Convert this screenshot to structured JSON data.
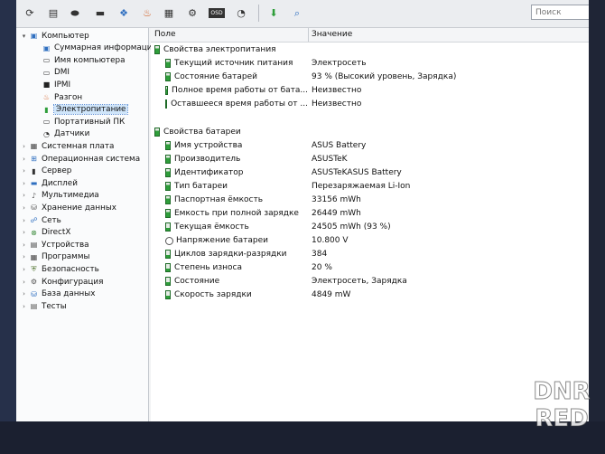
{
  "toolbar": {
    "buttons": [
      {
        "icon": "refresh-icon",
        "glyph": "⟳"
      },
      {
        "icon": "report-icon",
        "glyph": "▤"
      },
      {
        "icon": "motherboard-icon",
        "glyph": "⬬"
      },
      {
        "icon": "monitor-icon",
        "glyph": "▬"
      },
      {
        "icon": "memory-icon",
        "glyph": "❖"
      },
      {
        "icon": "flame-icon",
        "glyph": "♨"
      },
      {
        "icon": "calculator-icon",
        "glyph": "▦"
      },
      {
        "icon": "tools-icon",
        "glyph": "⚙"
      },
      {
        "icon": "osd-icon",
        "glyph": "OSD"
      },
      {
        "icon": "gauge-icon",
        "glyph": "◔"
      },
      {
        "icon": "update-download-icon",
        "glyph": "⬇"
      },
      {
        "icon": "search-icon",
        "glyph": "⌕"
      }
    ],
    "search_placeholder": "Поиск"
  },
  "tree": [
    {
      "label": "Компьютер",
      "icon": "computer-icon",
      "glyph": "▣",
      "level": 0,
      "arrow": "▾",
      "color": "#2f6fc0"
    },
    {
      "label": "Суммарная информация",
      "icon": "summary-icon",
      "glyph": "▣",
      "level": 1,
      "arrow": "",
      "color": "#2f6fc0"
    },
    {
      "label": "Имя компьютера",
      "icon": "computer-name-icon",
      "glyph": "▭",
      "level": 1,
      "arrow": "",
      "color": "#333"
    },
    {
      "label": "DMI",
      "icon": "dmi-icon",
      "glyph": "▭",
      "level": 1,
      "arrow": "",
      "color": "#333"
    },
    {
      "label": "IPMI",
      "icon": "ipmi-icon",
      "glyph": "■",
      "level": 1,
      "arrow": "",
      "color": "#222"
    },
    {
      "label": "Разгон",
      "icon": "overclock-icon",
      "glyph": "♨",
      "level": 1,
      "arrow": "",
      "color": "#d35a1c"
    },
    {
      "label": "Электропитание",
      "icon": "power-battery-icon",
      "glyph": "▮",
      "level": 1,
      "arrow": "",
      "color": "#2e9e3a",
      "selected": true
    },
    {
      "label": "Портативный ПК",
      "icon": "portable-pc-icon",
      "glyph": "▭",
      "level": 1,
      "arrow": "",
      "color": "#333"
    },
    {
      "label": "Датчики",
      "icon": "sensor-icon",
      "glyph": "◔",
      "level": 1,
      "arrow": "",
      "color": "#333"
    },
    {
      "label": "Системная плата",
      "icon": "motherboard-icon",
      "glyph": "▦",
      "level": 0,
      "arrow": "›",
      "color": "#444"
    },
    {
      "label": "Операционная система",
      "icon": "windows-icon",
      "glyph": "⊞",
      "level": 0,
      "arrow": "›",
      "color": "#2f6fc0"
    },
    {
      "label": "Сервер",
      "icon": "server-icon",
      "glyph": "▮",
      "level": 0,
      "arrow": "›",
      "color": "#333"
    },
    {
      "label": "Дисплей",
      "icon": "display-icon",
      "glyph": "▬",
      "level": 0,
      "arrow": "›",
      "color": "#2f6fc0"
    },
    {
      "label": "Мультимедиа",
      "icon": "multimedia-icon",
      "glyph": "♪",
      "level": 0,
      "arrow": "›",
      "color": "#555"
    },
    {
      "label": "Хранение данных",
      "icon": "storage-icon",
      "glyph": "⛁",
      "level": 0,
      "arrow": "›",
      "color": "#555"
    },
    {
      "label": "Сеть",
      "icon": "network-icon",
      "glyph": "☍",
      "level": 0,
      "arrow": "›",
      "color": "#2f6fc0"
    },
    {
      "label": "DirectX",
      "icon": "directx-icon",
      "glyph": "⊗",
      "level": 0,
      "arrow": "›",
      "color": "#3a8a3a"
    },
    {
      "label": "Устройства",
      "icon": "devices-icon",
      "glyph": "▤",
      "level": 0,
      "arrow": "›",
      "color": "#444"
    },
    {
      "label": "Программы",
      "icon": "programs-icon",
      "glyph": "▦",
      "level": 0,
      "arrow": "›",
      "color": "#444"
    },
    {
      "label": "Безопасность",
      "icon": "security-shield-icon",
      "glyph": "⛨",
      "level": 0,
      "arrow": "›",
      "color": "#5a7a3a"
    },
    {
      "label": "Конфигурация",
      "icon": "configuration-icon",
      "glyph": "⚙",
      "level": 0,
      "arrow": "›",
      "color": "#555"
    },
    {
      "label": "База данных",
      "icon": "database-icon",
      "glyph": "⛁",
      "level": 0,
      "arrow": "›",
      "color": "#2f6fc0"
    },
    {
      "label": "Тесты",
      "icon": "tests-icon",
      "glyph": "▤",
      "level": 0,
      "arrow": "›",
      "color": "#555"
    }
  ],
  "grid": {
    "col_field": "Поле",
    "col_value": "Значение",
    "rows": [
      {
        "type": "group",
        "field": "Свойства электропитания",
        "value": "",
        "icon": "bat"
      },
      {
        "type": "item",
        "field": "Текущий источник питания",
        "value": "Электросеть",
        "icon": "bat"
      },
      {
        "type": "item",
        "field": "Состояние батарей",
        "value": "93 % (Высокий уровень, Зарядка)",
        "icon": "bat"
      },
      {
        "type": "item",
        "field": "Полное время работы от бата...",
        "value": "Неизвестно",
        "icon": "bat"
      },
      {
        "type": "item",
        "field": "Оставшееся время работы от ...",
        "value": "Неизвестно",
        "icon": "bat"
      },
      {
        "type": "spacer"
      },
      {
        "type": "group",
        "field": "Свойства батареи",
        "value": "",
        "icon": "bat"
      },
      {
        "type": "item",
        "field": "Имя устройства",
        "value": "ASUS Battery",
        "icon": "bat"
      },
      {
        "type": "item",
        "field": "Производитель",
        "value": "ASUSTeK",
        "icon": "bat"
      },
      {
        "type": "item",
        "field": "Идентификатор",
        "value": "ASUSTeKASUS Battery",
        "icon": "bat"
      },
      {
        "type": "item",
        "field": "Тип батареи",
        "value": "Перезаряжаемая Li-Ion",
        "icon": "bat"
      },
      {
        "type": "item",
        "field": "Паспортная ёмкость",
        "value": "33156 mWh",
        "icon": "bat"
      },
      {
        "type": "item",
        "field": "Ёмкость при полной зарядке",
        "value": "26449 mWh",
        "icon": "bat"
      },
      {
        "type": "item",
        "field": "Текущая ёмкость",
        "value": "24505 mWh  (93 %)",
        "icon": "bat"
      },
      {
        "type": "item",
        "field": "Напряжение батареи",
        "value": "10.800 V",
        "icon": "volt"
      },
      {
        "type": "item",
        "field": "Циклов зарядки-разрядки",
        "value": "384",
        "icon": "bat"
      },
      {
        "type": "item",
        "field": "Степень износа",
        "value": "20 %",
        "icon": "bat"
      },
      {
        "type": "item",
        "field": "Состояние",
        "value": "Электросеть, Зарядка",
        "icon": "bat"
      },
      {
        "type": "item",
        "field": "Скорость зарядки",
        "value": "4849 mW",
        "icon": "bat"
      }
    ]
  },
  "watermark": {
    "line1": "DNR",
    "line2": "RED"
  }
}
